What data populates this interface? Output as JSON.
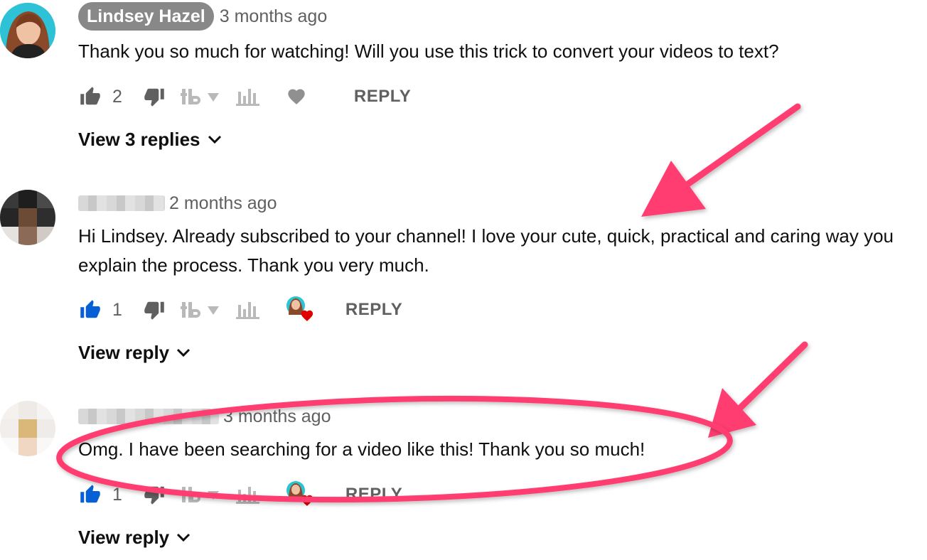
{
  "comments": [
    {
      "author": "Lindsey Hazel",
      "time": "3 months ago",
      "text": "Thank you so much for watching! Will you use this trick to convert your videos to text?",
      "likes": "2",
      "reply_label": "REPLY",
      "view_replies_label": "View 3 replies"
    },
    {
      "author": "",
      "time": "2 months ago",
      "text": "Hi Lindsey. Already subscribed to your channel! I love your cute, quick, practical and caring way you explain the process. Thank you very much.",
      "likes": "1",
      "reply_label": "REPLY",
      "view_replies_label": "View reply"
    },
    {
      "author": "",
      "time": "3 months ago",
      "text": "Omg. I have been searching for a video like this! Thank you so much!",
      "likes": "1",
      "reply_label": "REPLY",
      "view_replies_label": "View reply"
    }
  ],
  "icons": {
    "like": "thumb-up-icon",
    "dislike": "thumb-down-icon",
    "tubebuddy": "tubebuddy-icon",
    "stats": "bar-chart-icon",
    "heart": "heart-icon",
    "hearted_by_creator": "creator-heart-badge-icon",
    "chevron": "chevron-down-icon"
  },
  "colors": {
    "annotation": "#ff3d71",
    "liked_thumb": "#065fd4",
    "icon_gray": "#606060",
    "author_chip_bg": "#888888",
    "heart_red": "#e00000"
  }
}
